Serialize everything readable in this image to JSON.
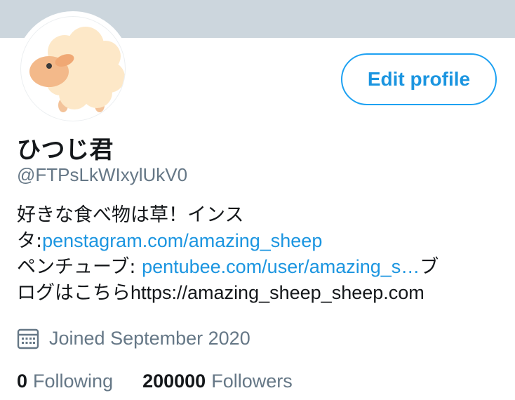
{
  "profile": {
    "name": "ひつじ君",
    "handle": "@FTPsLkWIxylUkV0",
    "edit_label": "Edit profile",
    "bio": {
      "line1": "好きな食べ物は草！インス",
      "line2_prefix": "タ:",
      "line2_link": "penstagram.com/amazing_sheep",
      "line3_prefix": "ペンチューブ: ",
      "line3_link": "pentubee.com/user/amazing_s…",
      "line3_suffix": "ブ",
      "line4_prefix": "ログはこちら",
      "line4_url": "https://amazing_sheep_sheep.com"
    },
    "joined": "Joined September 2020",
    "following_count": "0",
    "following_label": "Following",
    "followers_count": "200000",
    "followers_label": "Followers"
  },
  "icons": {
    "calendar": "calendar-icon",
    "avatar": "sheep-avatar"
  },
  "colors": {
    "accent": "#1da1f2",
    "link": "#1b95e0",
    "muted": "#657786",
    "banner": "#ccd6dd"
  }
}
